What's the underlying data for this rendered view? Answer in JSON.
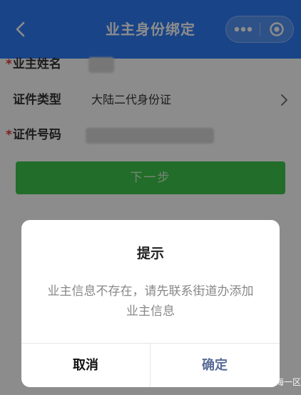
{
  "header": {
    "title": "业主身份绑定"
  },
  "form": {
    "owner_name_label": "业主姓名",
    "id_type_label": "证件类型",
    "id_type_value": "大陆二代身份证",
    "id_number_label": "证件号码",
    "required_mark": "*"
  },
  "next_button": "下一步",
  "dialog": {
    "title": "提示",
    "message": "业主信息不存在，请先联系街道办添加业主信息",
    "cancel": "取消",
    "confirm": "确定"
  },
  "watermark": {
    "text": "富力城二期海一区"
  },
  "colors": {
    "header_bg": "#2f7df6",
    "button_green": "#3fc64b",
    "required_red": "#e03a3a",
    "confirm_blue": "#576b95"
  },
  "icons": {
    "back": "chevron-left-icon",
    "more": "more-dots-icon",
    "close": "target-circle-icon",
    "chevron": "chevron-right-icon",
    "watermark": "wechat-official-account-icon"
  }
}
